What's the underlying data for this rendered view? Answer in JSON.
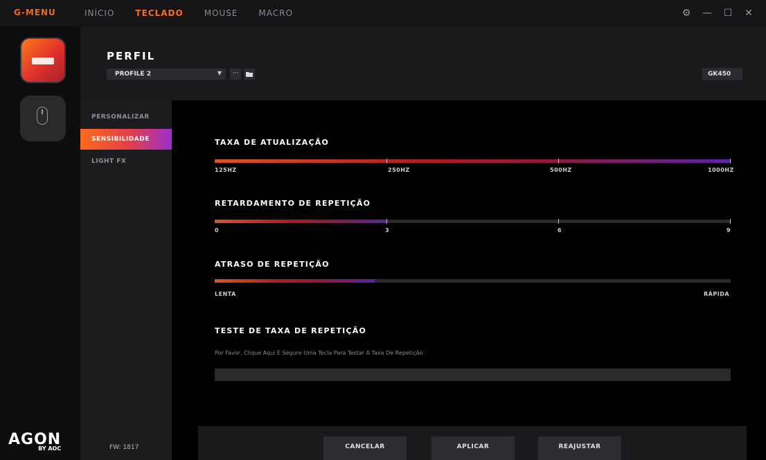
{
  "titlebar": {
    "brand": "G-MENU",
    "tabs": [
      {
        "label": "INÍCIO",
        "active": false
      },
      {
        "label": "TECLADO",
        "active": true
      },
      {
        "label": "MOUSE",
        "active": false
      },
      {
        "label": "MACRO",
        "active": false
      }
    ],
    "controls": {
      "settings": "⚙",
      "minimize": "—",
      "maximize": "☐",
      "close": "✕"
    }
  },
  "rail": {
    "logo_main": "AGON",
    "logo_sub": "BY AOC"
  },
  "header": {
    "title": "PERFIL",
    "profile": "PROFILE 2",
    "more_button": "···",
    "model": "GK450"
  },
  "menu": {
    "items": [
      {
        "label": "PERSONALIZAR",
        "active": false
      },
      {
        "label": "SENSIBILIDADE",
        "active": true
      },
      {
        "label": "LIGHT FX",
        "active": false
      }
    ],
    "firmware": "FW: 1817"
  },
  "sections": {
    "refresh": {
      "title": "TAXA DE ATUALIZAÇÃO",
      "labels": [
        "125HZ",
        "250HZ",
        "500HZ",
        "1000HZ"
      ],
      "value_fraction": 1.0
    },
    "delay": {
      "title": "RETARDAMENTO DE REPETIÇÃO",
      "labels": [
        "0",
        "3",
        "6",
        "9"
      ],
      "value": 3,
      "max": 9
    },
    "rate": {
      "title": "ATRASO DE REPETIÇÃO",
      "label_min": "LENTA",
      "label_max": "RÁPIDA",
      "value_fraction": 0.31
    },
    "test": {
      "title": "TESTE DE TAXA DE REPETIÇÃO",
      "hint": "Por Favor, Clique Aqui E Segure Uma Tecla Para Testar A Taxa De Repetição"
    }
  },
  "footer": {
    "cancel": "CANCELAR",
    "apply": "APLICAR",
    "reset": "REAJUSTAR"
  }
}
